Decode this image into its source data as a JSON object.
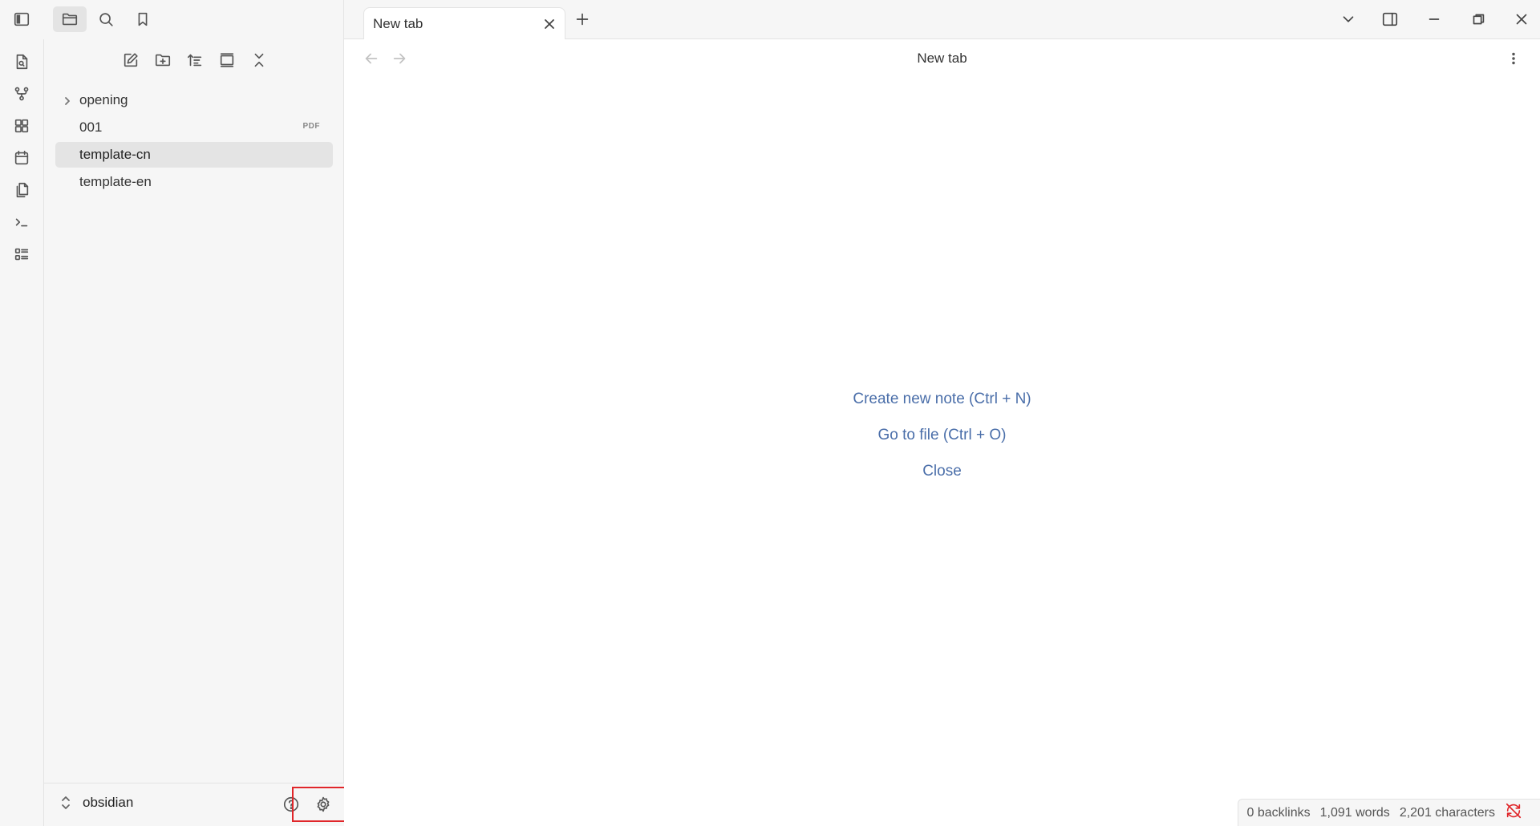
{
  "sidebar_tabs": {
    "files_icon": "folder-icon",
    "search_icon": "search-icon",
    "bookmarks_icon": "bookmark-icon"
  },
  "ribbon": {
    "items": [
      {
        "name": "open-quick-switcher",
        "icon": "file-search-icon"
      },
      {
        "name": "graph-view",
        "icon": "git-fork-icon"
      },
      {
        "name": "canvas",
        "icon": "layout-dashboard-icon"
      },
      {
        "name": "daily-notes",
        "icon": "calendar-icon"
      },
      {
        "name": "templates",
        "icon": "files-icon"
      },
      {
        "name": "command-palette",
        "icon": "terminal-icon"
      },
      {
        "name": "outline",
        "icon": "list-icon"
      }
    ]
  },
  "file_explorer": {
    "actions": [
      "new-note-icon",
      "new-folder-icon",
      "sort-icon",
      "auto-reveal-icon",
      "collapse-all-icon"
    ],
    "items": [
      {
        "label": "opening",
        "type": "folder",
        "badge": ""
      },
      {
        "label": "001",
        "type": "file",
        "badge": "PDF"
      },
      {
        "label": "template-cn",
        "type": "file",
        "badge": "",
        "selected": true
      },
      {
        "label": "template-en",
        "type": "file",
        "badge": ""
      }
    ]
  },
  "vault": {
    "name": "obsidian",
    "help_icon": "help-icon",
    "settings_icon": "settings-icon"
  },
  "tabs": [
    {
      "title": "New tab",
      "active": true
    }
  ],
  "view": {
    "title": "New tab",
    "actions": [
      {
        "label": "Create new note (Ctrl + N)"
      },
      {
        "label": "Go to file (Ctrl + O)"
      },
      {
        "label": "Close"
      }
    ]
  },
  "status": {
    "backlinks": "0 backlinks",
    "words": "1,091 words",
    "characters": "2,201 characters"
  },
  "colors": {
    "accent_link": "#4a6ea9",
    "highlight": "#e0262a"
  }
}
